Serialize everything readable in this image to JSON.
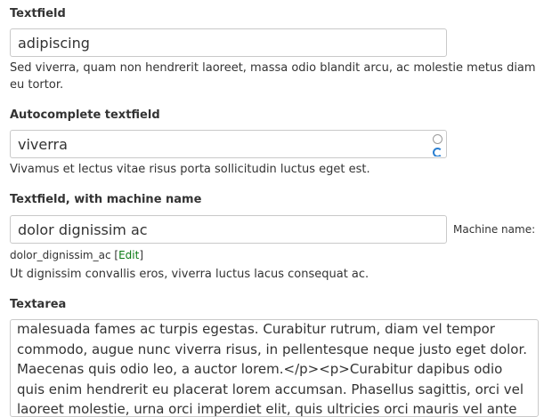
{
  "textfield": {
    "label": "Textfield",
    "value": "adipiscing",
    "description": "Sed viverra, quam non hendrerit laoreet, massa odio blandit arcu, ac molestie metus diam eu tortor."
  },
  "autocomplete": {
    "label": "Autocomplete textfield",
    "value": "viverra",
    "description": "Vivamus et lectus vitae risus porta sollicitudin luctus eget est."
  },
  "machine": {
    "label": "Textfield, with machine name",
    "value": "dolor dignissim ac",
    "machine_label": "Machine name:",
    "machine_value": "dolor_dignissim_ac",
    "open_bracket": "[",
    "edit_link": "Edit",
    "close_bracket": "]",
    "description": "Ut dignissim convallis eros, viverra luctus lacus consequat ac."
  },
  "textarea": {
    "label": "Textarea",
    "value": "malesuada fames ac turpis egestas. Curabitur rutrum, diam vel tempor commodo, augue nunc viverra risus, in pellentesque neque justo eget dolor. Maecenas quis odio leo, a auctor lorem.</p><p>Curabitur dapibus odio quis enim hendrerit eu placerat lorem accumsan. Phasellus sagittis, orci vel laoreet molestie, urna orci imperdiet elit, quis ultricies orci mauris vel ante"
  }
}
